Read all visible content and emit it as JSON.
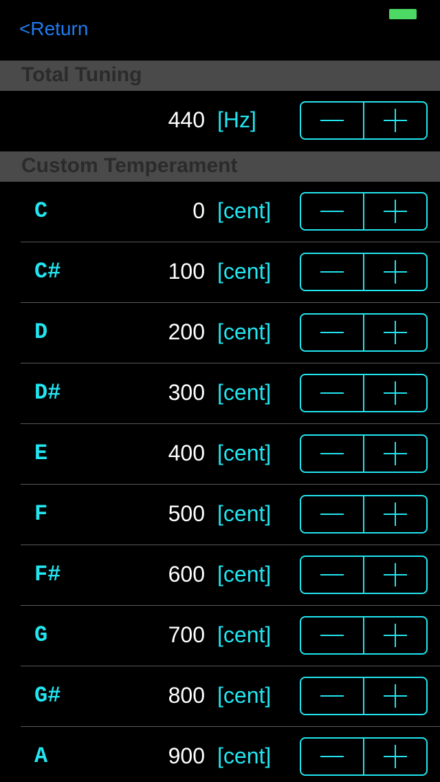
{
  "nav": {
    "back_label": "<Return"
  },
  "colors": {
    "accent": "#22e5f0",
    "back_link": "#1e7cf0",
    "battery": "#4cd964",
    "section_bg": "#4a4a4a",
    "section_text": "#2b2b2b"
  },
  "total_tuning": {
    "header": "Total Tuning",
    "value": "440",
    "unit": "[Hz]"
  },
  "custom_temperament": {
    "header": "Custom Temperament",
    "notes": [
      {
        "name": "C",
        "value": "0",
        "unit": "[cent]"
      },
      {
        "name": "C#",
        "value": "100",
        "unit": "[cent]"
      },
      {
        "name": "D",
        "value": "200",
        "unit": "[cent]"
      },
      {
        "name": "D#",
        "value": "300",
        "unit": "[cent]"
      },
      {
        "name": "E",
        "value": "400",
        "unit": "[cent]"
      },
      {
        "name": "F",
        "value": "500",
        "unit": "[cent]"
      },
      {
        "name": "F#",
        "value": "600",
        "unit": "[cent]"
      },
      {
        "name": "G",
        "value": "700",
        "unit": "[cent]"
      },
      {
        "name": "G#",
        "value": "800",
        "unit": "[cent]"
      },
      {
        "name": "A",
        "value": "900",
        "unit": "[cent]"
      }
    ]
  },
  "icons": {
    "decrement": "minus-icon",
    "increment": "plus-icon",
    "battery": "battery-icon"
  }
}
